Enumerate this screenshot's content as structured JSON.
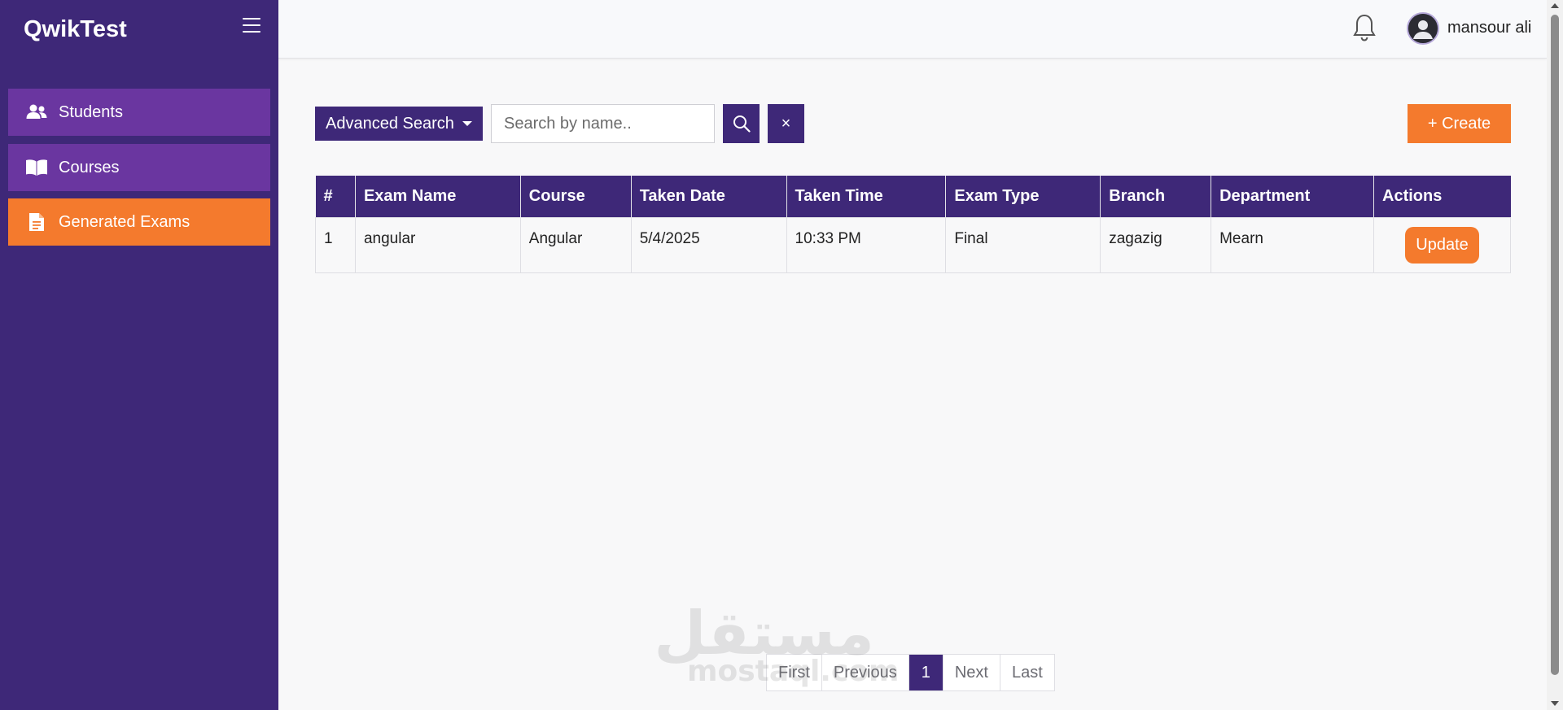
{
  "app": {
    "brand": "QwikTest"
  },
  "sidebar": {
    "items": [
      {
        "label": "Students",
        "icon": "users-icon"
      },
      {
        "label": "Courses",
        "icon": "book-icon"
      },
      {
        "label": "Generated Exams",
        "icon": "document-icon",
        "active": true
      }
    ]
  },
  "topbar": {
    "username": "mansour ali"
  },
  "toolbar": {
    "advanced_search_label": "Advanced Search",
    "search_placeholder": "Search by name..",
    "search_value": "",
    "clear_label": "×",
    "create_label": "+ Create"
  },
  "table": {
    "headers": [
      "#",
      "Exam Name",
      "Course",
      "Taken Date",
      "Taken Time",
      "Exam Type",
      "Branch",
      "Department",
      "Actions"
    ],
    "rows": [
      {
        "index": "1",
        "exam_name": "angular",
        "course": "Angular",
        "taken_date": "5/4/2025",
        "taken_time": "10:33 PM",
        "exam_type": "Final",
        "branch": "zagazig",
        "department": "Mearn",
        "action_label": "Update"
      }
    ]
  },
  "pagination": {
    "first": "First",
    "previous": "Previous",
    "current": "1",
    "next": "Next",
    "last": "Last"
  },
  "watermark": {
    "arabic": "مستقل",
    "latin": "mostaql.com"
  },
  "colors": {
    "primary": "#3e2878",
    "accent": "#f47a2d",
    "nav_item": "#6a36a0"
  }
}
